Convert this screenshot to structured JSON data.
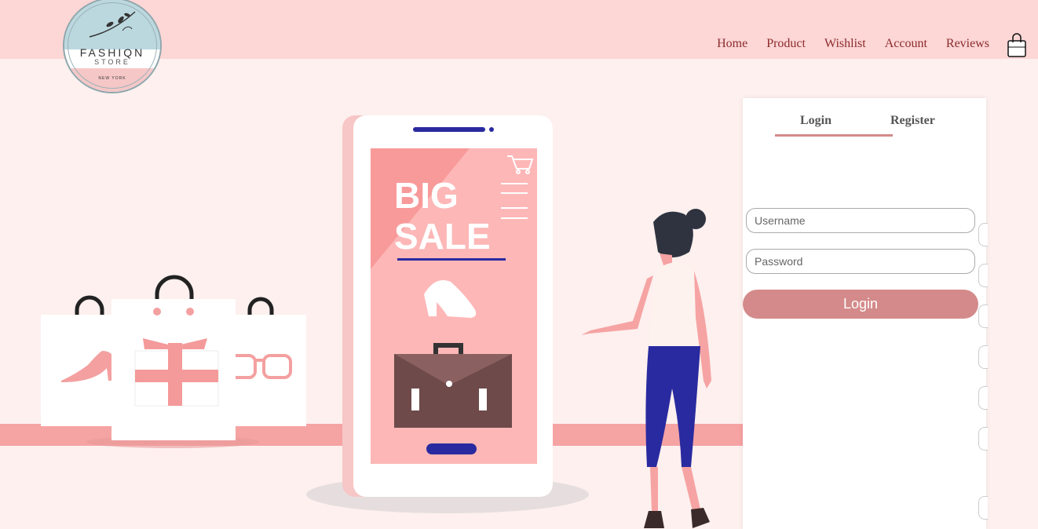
{
  "brand": {
    "name": "FASHIQN",
    "sub": "STORE",
    "city": "NEW YORK"
  },
  "nav": {
    "items": [
      "Home",
      "Product",
      "Wishlist",
      "Account",
      "Reviews"
    ]
  },
  "hero": {
    "line1": "BIG",
    "line2": "SALE"
  },
  "auth": {
    "tab_login": "Login",
    "tab_register": "Register",
    "username_placeholder": "Username",
    "password_placeholder": "Password",
    "submit_label": "Login"
  },
  "colors": {
    "topbar": "#fdd6d6",
    "accent": "#d48a8a",
    "nav_text": "#8b2b2b",
    "background": "#fdf0ee"
  }
}
